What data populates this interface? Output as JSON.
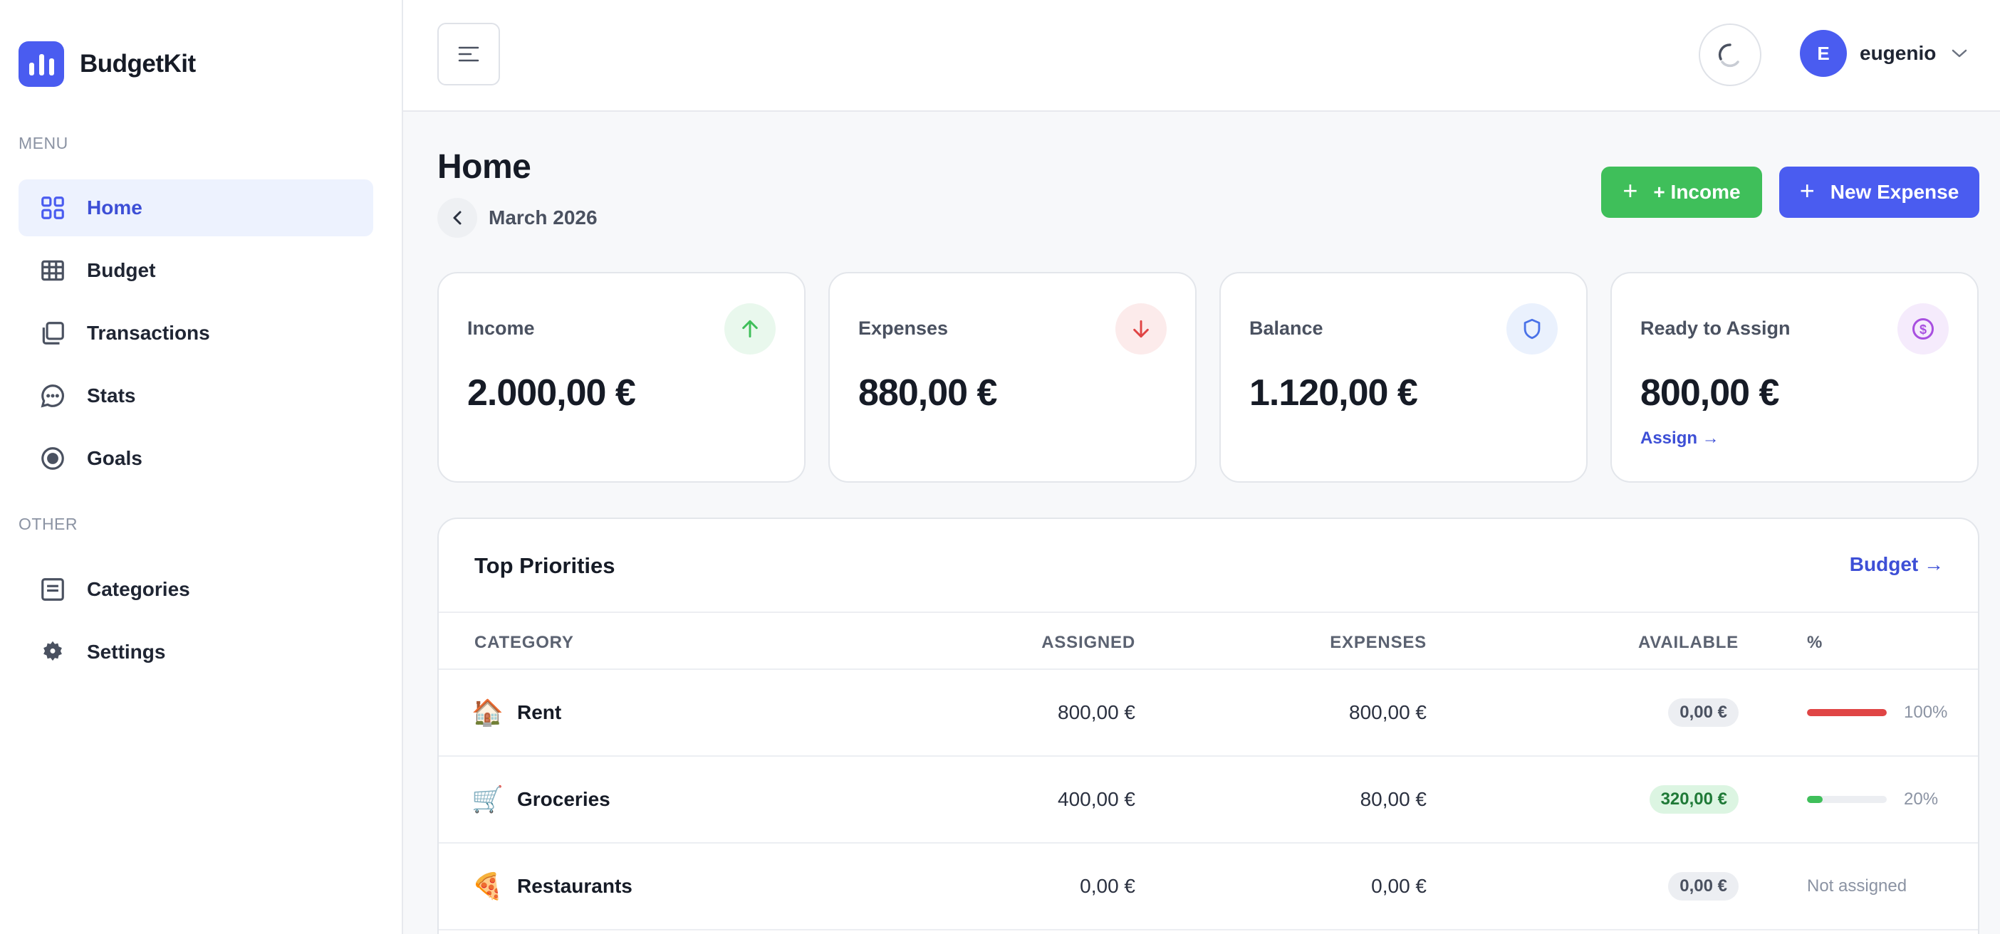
{
  "app": {
    "name": "BudgetKit"
  },
  "sidebar": {
    "menu_label": "MENU",
    "other_label": "OTHER",
    "items": [
      {
        "label": "Home",
        "icon": "grid-icon"
      },
      {
        "label": "Budget",
        "icon": "table-icon"
      },
      {
        "label": "Transactions",
        "icon": "copy-icon"
      },
      {
        "label": "Stats",
        "icon": "chat-icon"
      },
      {
        "label": "Goals",
        "icon": "target-icon"
      }
    ],
    "other_items": [
      {
        "label": "Categories",
        "icon": "list-icon"
      },
      {
        "label": "Settings",
        "icon": "gear-icon"
      }
    ]
  },
  "header": {
    "user_initial": "E",
    "username": "eugenio"
  },
  "page": {
    "title": "Home",
    "month": "March 2026",
    "income_button": "+ Income",
    "expense_button": "New Expense"
  },
  "cards": [
    {
      "label": "Income",
      "value": "2.000,00 €",
      "icon": "arrow-up-icon",
      "color": "#3fbf5a"
    },
    {
      "label": "Expenses",
      "value": "880,00 €",
      "icon": "arrow-down-icon",
      "color": "#e04545"
    },
    {
      "label": "Balance",
      "value": "1.120,00 €",
      "icon": "shield-icon",
      "color": "#4a72e8"
    },
    {
      "label": "Ready to Assign",
      "value": "800,00 €",
      "icon": "dollar-icon",
      "color": "#a84fe0",
      "link": "Assign →"
    }
  ],
  "priorities": {
    "title": "Top Priorities",
    "link": "Budget →",
    "columns": [
      "CATEGORY",
      "ASSIGNED",
      "EXPENSES",
      "AVAILABLE",
      "%"
    ],
    "rows": [
      {
        "emoji": "🏠",
        "name": "Rent",
        "assigned": "800,00 €",
        "expenses": "800,00 €",
        "available": "0,00 €",
        "percent": "100%",
        "progress": 1.0,
        "bar_color": "#e04545"
      },
      {
        "emoji": "🛒",
        "name": "Groceries",
        "assigned": "400,00 €",
        "expenses": "80,00 €",
        "available": "320,00 €",
        "percent": "20%",
        "progress": 0.2,
        "bar_color": "#3fbf5a"
      },
      {
        "emoji": "🍕",
        "name": "Restaurants",
        "assigned": "0,00 €",
        "expenses": "0,00 €",
        "available": "0,00 €",
        "status": "Not assigned"
      }
    ]
  },
  "colors": {
    "accent": "#4a5cf0",
    "success": "#3fbf5a",
    "danger": "#e04545"
  }
}
